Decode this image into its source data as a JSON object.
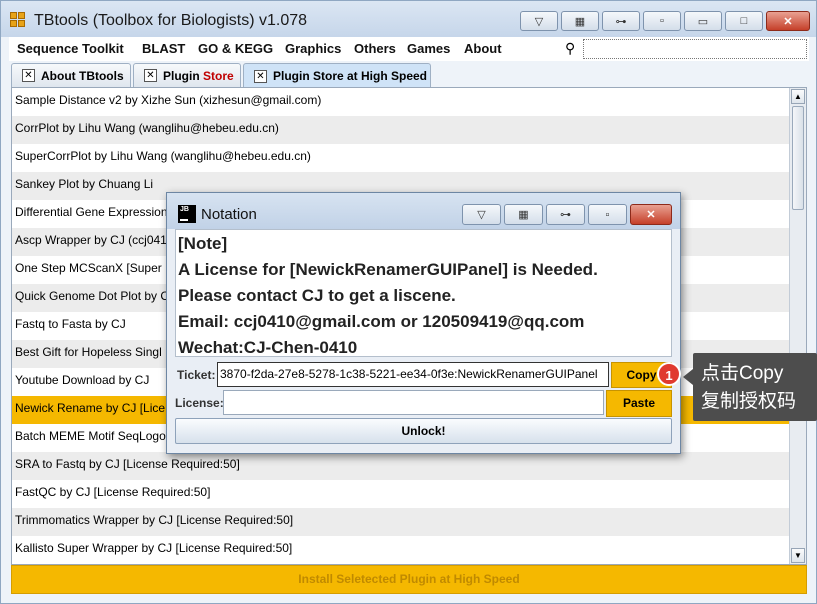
{
  "window": {
    "title": "TBtools (Toolbox for Biologists) v1.078"
  },
  "menu": [
    "Sequence Toolkit",
    "BLAST",
    "GO & KEGG",
    "Graphics",
    "Others",
    "Games",
    "About"
  ],
  "search": {
    "placeholder": ""
  },
  "tabs": [
    {
      "label": "About TBtools"
    },
    {
      "label_plain": "Plugin ",
      "label_red": "Store"
    },
    {
      "label": "Plugin Store at High Speed"
    }
  ],
  "plugins": [
    "Sample Distance v2 by Xizhe Sun (xizhesun@gmail.com)",
    "CorrPlot by Lihu Wang (wanglihu@hebeu.edu.cn)",
    "SuperCorrPlot by Lihu Wang (wanglihu@hebeu.edu.cn)",
    "Sankey Plot by Chuang Li",
    "Differential Gene Expression",
    "Ascp Wrapper by CJ (ccj041",
    "One Step MCScanX [Super F",
    "Quick Genome Dot Plot by C",
    "Fastq to Fasta by CJ",
    "Best Gift for Hopeless Singl",
    "Youtube Download by CJ",
    "Newick Rename by CJ [Lice",
    "Batch MEME Motif SeqLogo",
    "SRA to Fastq by CJ [License Required:50]",
    "FastQC by CJ [License Required:50]",
    "Trimmomatics Wrapper by CJ [License Required:50]",
    "Kallisto Super Wrapper by CJ [License Required:50]"
  ],
  "selected_index": 11,
  "install_button": "Install Seletected Plugin at High Speed",
  "dialog": {
    "title": "Notation",
    "icon_text": "JB",
    "note_lines": [
      "[Note]",
      "A License for [NewickRenamerGUIPanel] is Needed.",
      "Please contact CJ to get a liscene.",
      "Email: ccj0410@gmail.com or 120509419@qq.com",
      "Wechat:CJ-Chen-0410"
    ],
    "ticket_label": "Ticket:",
    "ticket_value": "3870-f2da-27e8-5278-1c38-5221-ee34-0f3e:NewickRenamerGUIPanel",
    "license_label": "License:",
    "license_value": "",
    "copy_label": "Copy",
    "paste_label": "Paste",
    "unlock_label": "Unlock!"
  },
  "annotation": {
    "badge": "1",
    "tooltip_line1": "点击Copy",
    "tooltip_line2": "复制授权码"
  },
  "colors": {
    "accent": "#f5b800",
    "badge": "#e03a2f",
    "tooltip": "#4d4d4d"
  },
  "icons": [
    "app-icon",
    "search-icon",
    "close-tab-icon",
    "jb-icon",
    "minimize-icon",
    "maximize-icon",
    "close-icon",
    "scroll-up-icon",
    "scroll-down-icon"
  ]
}
